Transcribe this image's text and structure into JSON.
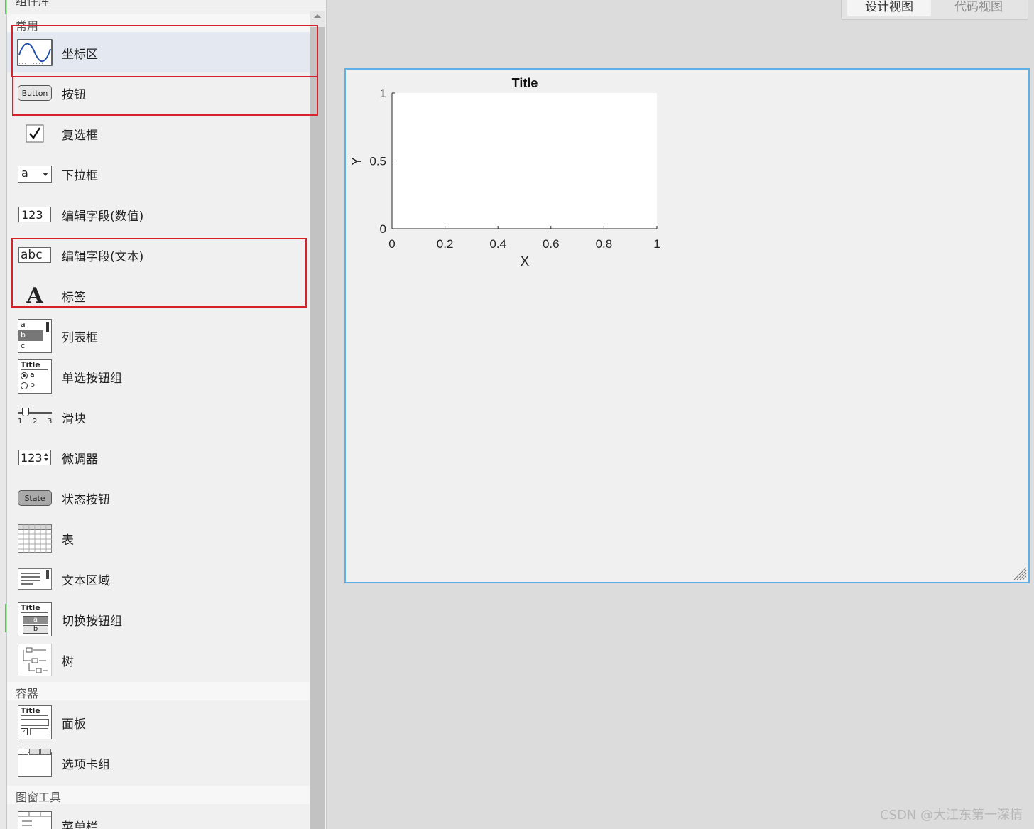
{
  "library": {
    "header": "组件库",
    "sections": {
      "common": "常用",
      "containers": "容器",
      "figure_tools": "图窗工具"
    },
    "items": {
      "axes": "坐标区",
      "button": "按钮",
      "checkbox": "复选框",
      "dropdown": "下拉框",
      "numeric_field": "编辑字段(数值)",
      "text_field": "编辑字段(文本)",
      "label": "标签",
      "listbox": "列表框",
      "radio_group": "单选按钮组",
      "slider": "滑块",
      "spinner": "微调器",
      "state_button": "状态按钮",
      "table": "表",
      "text_area": "文本区域",
      "toggle_group": "切换按钮组",
      "tree": "树",
      "panel": "面板",
      "tab_group": "选项卡组",
      "menu_bar": "菜单栏"
    },
    "icon_text": {
      "button": "Button",
      "dropdown": "a",
      "numeric": "123",
      "text": "abc",
      "label": "A",
      "list_a": "a",
      "list_b": "b",
      "list_c": "c",
      "title": "Title",
      "radio_a": "a",
      "radio_b": "b",
      "slider_1": "1",
      "slider_2": "2",
      "slider_3": "3",
      "spinner": "123",
      "state": "State",
      "toggle_a": "a",
      "toggle_b": "b"
    }
  },
  "tabs": {
    "design": "设计视图",
    "code": "代码视图"
  },
  "chart_data": {
    "type": "line",
    "title": "Title",
    "xlabel": "X",
    "ylabel": "Y",
    "xlim": [
      0,
      1
    ],
    "ylim": [
      0,
      1
    ],
    "xticks": [
      "0",
      "0.2",
      "0.4",
      "0.6",
      "0.8",
      "1"
    ],
    "yticks": [
      "0",
      "0.5",
      "1"
    ],
    "series": []
  },
  "watermark": "CSDN @大江东第一深情",
  "colors": {
    "selection_box": "#d6202c",
    "canvas_border": "#5fb0e8",
    "selected_item": "#e4e9f1"
  }
}
